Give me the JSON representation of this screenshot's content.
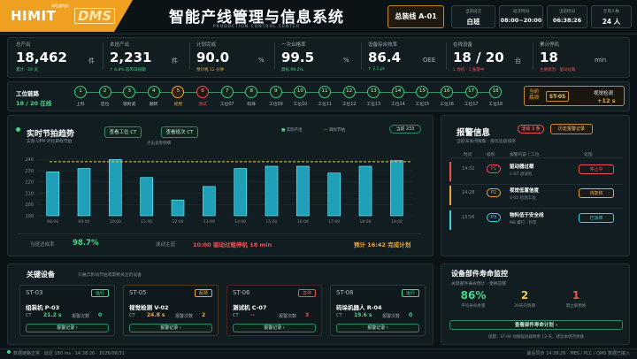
{
  "header": {
    "logo_main": "HIMIT",
    "logo_dms": "DMS",
    "logo_sub": "海旺通科技",
    "title": "智能产线管理与信息系统",
    "subtitle": "PRODUCTION CONTROL CENTER",
    "line": "总装线 A-01",
    "info": [
      {
        "label": "当前班次",
        "value": "白班"
      },
      {
        "label": "班次时间",
        "value": "08:00~20:00"
      },
      {
        "label": "当前时间",
        "value": "06:38:26"
      },
      {
        "label": "在岗人数",
        "value": "24 人"
      }
    ]
  },
  "kpis": [
    {
      "label": "总产出",
      "value": "18,462",
      "unit": "件",
      "sub": "累计 · 20 天",
      "color": "#43d98a"
    },
    {
      "label": "本班产出",
      "value": "2,231",
      "unit": "件",
      "sub": "↑ 6.8% 较昨日同期",
      "color": "#43d98a"
    },
    {
      "label": "计划完成",
      "value": "90.0",
      "unit": "%",
      "sub": "预计晚 12 分钟",
      "color": "#f1a53a"
    },
    {
      "label": "一次合格率",
      "value": "99.5",
      "unit": "%",
      "sub": "目标 99.2%",
      "color": "#43d98a"
    },
    {
      "label": "设备综合效率",
      "value": "86.4",
      "unit": "OEE",
      "sub": "↑ 2.1 pt",
      "color": "#43d98a"
    },
    {
      "label": "在线设备",
      "value": "18 / 20",
      "unit": "台",
      "sub": "1 停机 · 1 报警中",
      "color": "#ef5050"
    },
    {
      "label": "累计停机",
      "value": "18",
      "unit": "min",
      "sub": "主要原因：驱动过载",
      "color": "#ef5050"
    }
  ],
  "stations": {
    "title": "工位链路",
    "online": "18 / 20 在线",
    "items": [
      {
        "n": "1",
        "label": "上料",
        "s": "ok"
      },
      {
        "n": "2",
        "label": "定位",
        "s": "ok"
      },
      {
        "n": "3",
        "label": "锁附紧",
        "s": "ok"
      },
      {
        "n": "4",
        "label": "翻转",
        "s": "ok"
      },
      {
        "n": "5",
        "label": "视觉",
        "s": "warn"
      },
      {
        "n": "6",
        "label": "测试",
        "s": "err"
      },
      {
        "n": "7",
        "label": "工位07",
        "s": "ok"
      },
      {
        "n": "8",
        "label": "码垛",
        "s": "ok"
      },
      {
        "n": "9",
        "label": "工位09",
        "s": "ok"
      },
      {
        "n": "10",
        "label": "工位10",
        "s": "ok"
      },
      {
        "n": "11",
        "label": "工位11",
        "s": "ok"
      },
      {
        "n": "12",
        "label": "工位12",
        "s": "ok"
      },
      {
        "n": "13",
        "label": "工位13",
        "s": "ok"
      },
      {
        "n": "14",
        "label": "工位14",
        "s": "ok"
      },
      {
        "n": "15",
        "label": "工位15",
        "s": "ok"
      },
      {
        "n": "16",
        "label": "工位16",
        "s": "ok"
      },
      {
        "n": "17",
        "label": "工位17",
        "s": "ok"
      },
      {
        "n": "18",
        "label": "工位18",
        "s": "ok"
      }
    ],
    "bottleneck_label": "当前瓶颈",
    "bottleneck_station": "ST-05",
    "bottleneck_name": "视觉检测",
    "bottleneck_delta": "+12 s"
  },
  "trend": {
    "title": "实时节拍趋势",
    "subtitle": "实际 UPH 对比目标节拍",
    "btn1": "查看工位 CT",
    "btn2": "查看班次 CT",
    "legend_actual": "实际产出",
    "legend_target": "目标节拍",
    "hint": "点击查看明细",
    "tag": "当前 233",
    "rate_label": "当班达成率",
    "rate_value": "98.7%",
    "reason_label": "波动主因",
    "reason_value": "10:00 驱动过载停机 18 min",
    "forecast": "预计 16:42 完成计划"
  },
  "chart_data": {
    "type": "bar",
    "categories": [
      "08:00",
      "09:00",
      "10:00",
      "11:00",
      "12:00",
      "13:00",
      "14:00",
      "15:00",
      "16:00",
      "17:00",
      "18:00",
      "19:00"
    ],
    "values": [
      229,
      232,
      240,
      224,
      204,
      216,
      232,
      234,
      234,
      228,
      234,
      239
    ],
    "target": 238,
    "ylim": [
      190,
      245
    ],
    "yticks": [
      190,
      200,
      210,
      220,
      230,
      240
    ]
  },
  "alarms": {
    "title": "报警信息",
    "active": "活动 3 条",
    "history_btn": "历史报警记录",
    "subtitle": "当前未关闭报警 · 按优先级排序",
    "cols": [
      "时间",
      "级别",
      "报警内容 / 工位",
      "处理"
    ],
    "rows": [
      {
        "time": "14:32",
        "level": "P1",
        "title": "驱动器过载",
        "detail": "C-07 测试机",
        "action": "停止中",
        "color": "#ef5050"
      },
      {
        "time": "14:28",
        "level": "P2",
        "title": "视觉低置信度",
        "detail": "V-02 检测工位",
        "action": "待复核",
        "color": "#f1a53a"
      },
      {
        "time": "13:56",
        "level": "P3",
        "title": "物料低于安全线",
        "detail": "M8 螺钉 · 料架",
        "action": "已派单",
        "color": "#35d4e4"
      }
    ]
  },
  "devices": {
    "title": "关键设备",
    "subtitle": "只展示影响节拍或需要关注的设备",
    "ct_label": "CT",
    "alarm_label": "报警次数",
    "record_label": "报警记录 ›",
    "items": [
      {
        "id": "ST-03",
        "state": "运行",
        "name": "组装机 P-03",
        "ct": "21.2 s",
        "alarms": "0",
        "color": "#43d98a"
      },
      {
        "id": "ST-05",
        "state": "瓶颈",
        "name": "视觉检测 V-02",
        "ct": "24.8 s",
        "alarms": "2",
        "color": "#f1a53a"
      },
      {
        "id": "ST-06",
        "state": "急停",
        "name": "测试机 C-07",
        "ct": "--",
        "alarms": "3",
        "color": "#ef5050"
      },
      {
        "id": "ST-08",
        "state": "运行",
        "name": "码垛机器人 R-04",
        "ct": "19.6 s",
        "alarms": "0",
        "color": "#43d98a"
      }
    ]
  },
  "life": {
    "title": "设备部件寿命监控",
    "subtitle": "关键部件寿命预计 · 更换提醒",
    "stats": [
      {
        "value": "86%",
        "label": "平均寿命余量",
        "color": "#43d98a"
      },
      {
        "value": "2",
        "label": "30天内到期",
        "color": "#f2c94c"
      },
      {
        "value": "1",
        "label": "需立即更换",
        "color": "#ef5050"
      }
    ],
    "btn": "查看部件寿命计划 ›",
    "note": "提醒：ST-06 伺服驱动器剩余 12 天，建议本周内更换"
  },
  "footer": {
    "left": "数据链路正常 · 延迟 180 ms · 14:38:26 · 2026/08/31",
    "right": "最后同步 14:38:26 · MES / PLC / QMS 数据已接入"
  }
}
